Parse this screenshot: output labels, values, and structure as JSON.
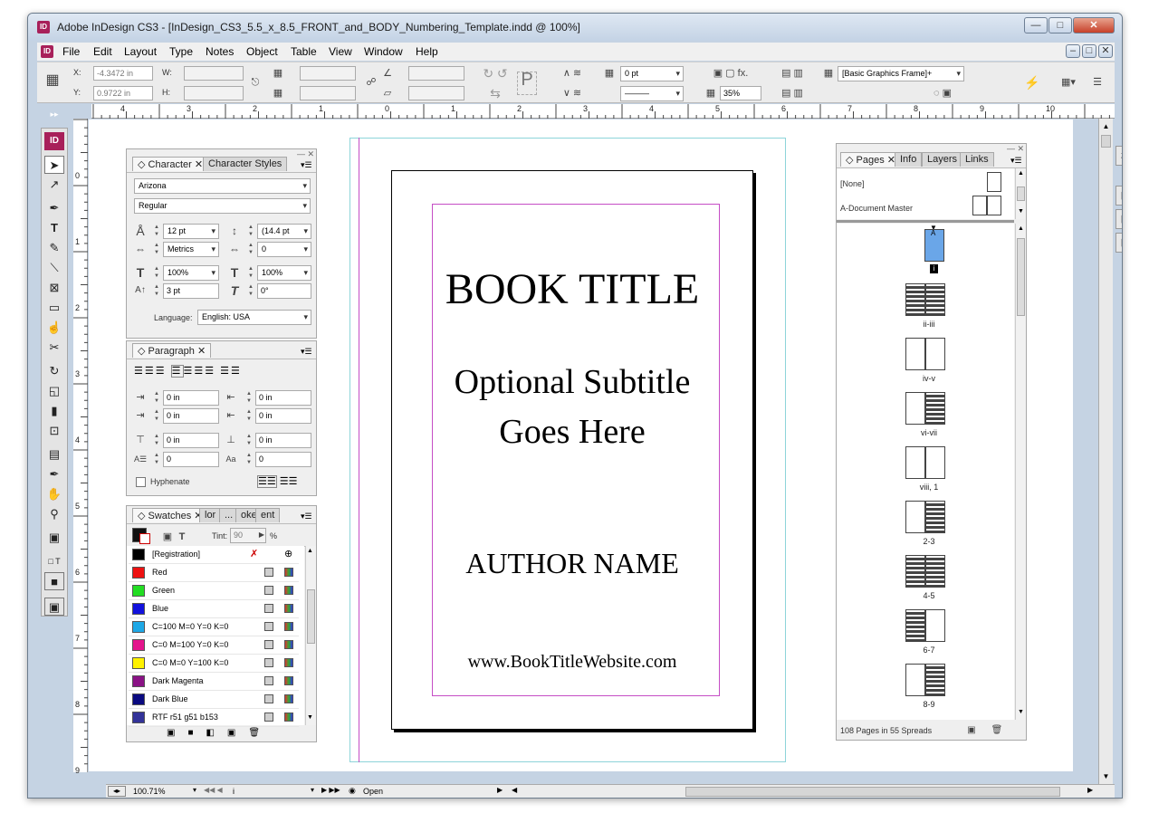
{
  "window": {
    "app_icon": "ID",
    "title": "Adobe InDesign CS3 - [InDesign_CS3_5.5_x_8.5_FRONT_and_BODY_Numbering_Template.indd @ 100%]",
    "min": "—",
    "restore": "□",
    "close": "✕"
  },
  "menu": [
    "File",
    "Edit",
    "Layout",
    "Type",
    "Notes",
    "Object",
    "Table",
    "View",
    "Window",
    "Help"
  ],
  "doc_controls": {
    "min": "–",
    "restore": "□",
    "close": "✕"
  },
  "control_panel": {
    "x_label": "X:",
    "x_value": "-4.3472 in",
    "y_label": "Y:",
    "y_value": "0.9722 in",
    "w_label": "W:",
    "h_label": "H:",
    "stroke_weight": "0 pt",
    "opacity": "35%",
    "object_style": "[Basic Graphics Frame]+"
  },
  "ruler_h": [
    "4",
    "3",
    "2",
    "1",
    "0",
    "1",
    "2",
    "3",
    "4",
    "5",
    "6",
    "7",
    "8",
    "9",
    "10"
  ],
  "ruler_v": [
    "0",
    "1",
    "2",
    "3",
    "4",
    "5",
    "6",
    "7",
    "8",
    "9"
  ],
  "tools_app_icon": "ID",
  "character_panel": {
    "tab_active": "Character",
    "tab_inactive": "Character Styles",
    "font_family": "Arizona",
    "font_style": "Regular",
    "size": "12 pt",
    "leading": "(14.4 pt",
    "kerning": "Metrics",
    "tracking": "0",
    "vscale": "100%",
    "hscale": "100%",
    "baseline": "3 pt",
    "skew": "0°",
    "language_label": "Language:",
    "language": "English: USA"
  },
  "paragraph_panel": {
    "tab": "Paragraph",
    "left_indent": "0 in",
    "right_indent": "0 in",
    "first_indent": "0 in",
    "last_indent": "0 in",
    "space_before": "0 in",
    "space_after": "0 in",
    "drop_lines": "0",
    "drop_chars": "0",
    "hyphenate_label": "Hyphenate"
  },
  "swatches_panel": {
    "tab": "Swatches",
    "tab_others": [
      "lor",
      "...",
      "oke",
      "ent"
    ],
    "tint_label": "Tint:",
    "tint_value": "90",
    "tint_unit": "%",
    "swatches": [
      {
        "name": "[Registration]",
        "color": "#000000"
      },
      {
        "name": "Red",
        "color": "#ee1111"
      },
      {
        "name": "Green",
        "color": "#22dd22"
      },
      {
        "name": "Blue",
        "color": "#1111dd"
      },
      {
        "name": "C=100 M=0 Y=0 K=0",
        "color": "#1ea8e6"
      },
      {
        "name": "C=0 M=100 Y=0 K=0",
        "color": "#e4148c"
      },
      {
        "name": "C=0 M=0 Y=100 K=0",
        "color": "#fff200"
      },
      {
        "name": "Dark Magenta",
        "color": "#8a1285"
      },
      {
        "name": "Dark Blue",
        "color": "#0a0a80"
      },
      {
        "name": "RTF r51 g51 b153",
        "color": "#333399"
      }
    ]
  },
  "document_page": {
    "title": "BOOK TITLE",
    "subtitle_line1": "Optional Subtitle",
    "subtitle_line2": "Goes Here",
    "author": "AUTHOR NAME",
    "website": "www.BookTitleWebsite.com"
  },
  "pages_panel": {
    "tabs": [
      "Pages",
      "Info",
      "Layers",
      "Links"
    ],
    "master_none": "[None]",
    "master_a": "A-Document Master",
    "first_page_marker": "i",
    "spread_labels": [
      "ii-iii",
      "iv-v",
      "vi-vii",
      "viii, 1",
      "2-3",
      "4-5",
      "6-7",
      "8-9"
    ],
    "master_letter": "A",
    "summary": "108 Pages in 55 Spreads"
  },
  "status_bar": {
    "zoom": "100.71%",
    "page": "i",
    "state": "Open"
  }
}
